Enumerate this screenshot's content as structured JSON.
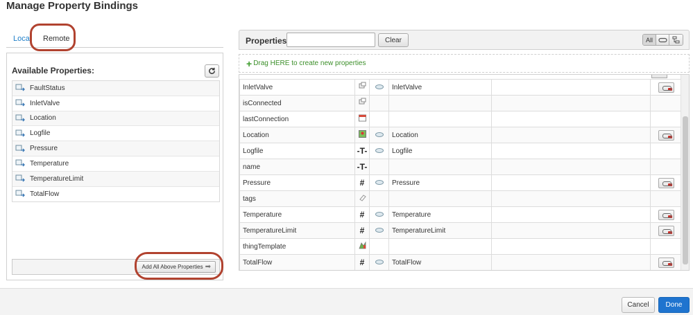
{
  "dialog": {
    "title": "Manage Property Bindings"
  },
  "tabs": {
    "local": "Local",
    "remote": "Remote"
  },
  "available": {
    "title": "Available Properties:",
    "refresh_icon": "refresh-icon",
    "items": [
      {
        "label": "FaultStatus"
      },
      {
        "label": "InletValve"
      },
      {
        "label": "Location"
      },
      {
        "label": "Logfile"
      },
      {
        "label": "Pressure"
      },
      {
        "label": "Temperature"
      },
      {
        "label": "TemperatureLimit"
      },
      {
        "label": "TotalFlow"
      }
    ],
    "add_all_label": "Add All Above Properties"
  },
  "properties": {
    "title": "Properties",
    "search_value": "",
    "clear_label": "Clear",
    "filter": {
      "all_label": "All",
      "selected": "All"
    },
    "drag_hint": "Drag HERE to create new properties",
    "rows": [
      {
        "name": "InletValve",
        "type_icon": "infotable-icon",
        "bound": true,
        "source": "InletValve",
        "unbind": true
      },
      {
        "name": "isConnected",
        "type_icon": "boolean-icon",
        "bound": false,
        "source": "",
        "unbind": false
      },
      {
        "name": "lastConnection",
        "type_icon": "datetime-icon",
        "bound": false,
        "source": "",
        "unbind": false
      },
      {
        "name": "Location",
        "type_icon": "location-icon",
        "bound": true,
        "source": "Location",
        "unbind": true
      },
      {
        "name": "Logfile",
        "type_icon": "string-icon",
        "type_glyph": "-T-",
        "bound": true,
        "source": "Logfile",
        "unbind": false
      },
      {
        "name": "name",
        "type_icon": "string-icon",
        "type_glyph": "-T-",
        "bound": false,
        "source": "",
        "unbind": false
      },
      {
        "name": "Pressure",
        "type_icon": "number-icon",
        "type_glyph": "#",
        "bound": true,
        "source": "Pressure",
        "unbind": true
      },
      {
        "name": "tags",
        "type_icon": "tags-icon",
        "bound": false,
        "source": "",
        "unbind": false
      },
      {
        "name": "Temperature",
        "type_icon": "number-icon",
        "type_glyph": "#",
        "bound": true,
        "source": "Temperature",
        "unbind": true
      },
      {
        "name": "TemperatureLimit",
        "type_icon": "number-icon",
        "type_glyph": "#",
        "bound": true,
        "source": "TemperatureLimit",
        "unbind": true
      },
      {
        "name": "thingTemplate",
        "type_icon": "thingtemplate-icon",
        "bound": false,
        "source": "",
        "unbind": false
      },
      {
        "name": "TotalFlow",
        "type_icon": "number-icon",
        "type_glyph": "#",
        "bound": true,
        "source": "TotalFlow",
        "unbind": true
      }
    ]
  },
  "footer": {
    "cancel_label": "Cancel",
    "done_label": "Done"
  },
  "colors": {
    "accent": "#1f74cf",
    "annotation_ring": "#b1422f",
    "drag_hint": "#3c8f2a",
    "unbind_red": "#c8302a"
  }
}
